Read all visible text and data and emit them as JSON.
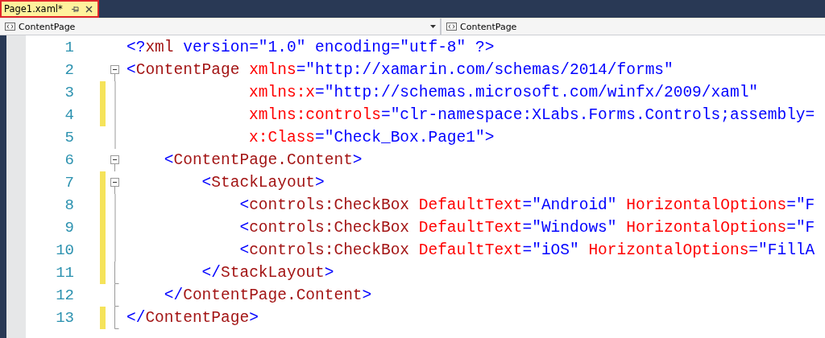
{
  "tab": {
    "title": "Page1.xaml*",
    "highlighted": true
  },
  "nav_bar": {
    "left": "ContentPage",
    "right": "ContentPage"
  },
  "editor": {
    "lines": [
      {
        "number": "1",
        "changed": false,
        "fold_start": false,
        "fold_end": false,
        "tokens": [
          {
            "kind": "punct",
            "text": "<?"
          },
          {
            "kind": "element",
            "text": "xml"
          },
          {
            "kind": "value",
            "text": " version=\"1.0\" encoding=\"utf-8\" "
          },
          {
            "kind": "punct",
            "text": "?>"
          }
        ]
      },
      {
        "number": "2",
        "changed": false,
        "fold_start": true,
        "fold_end": false,
        "tokens": [
          {
            "kind": "punct",
            "text": "<"
          },
          {
            "kind": "element",
            "text": "ContentPage"
          },
          {
            "kind": "attr",
            "text": " xmlns"
          },
          {
            "kind": "punct",
            "text": "="
          },
          {
            "kind": "value",
            "text": "\"http://xamarin.com/schemas/2014/forms\""
          }
        ]
      },
      {
        "number": "3",
        "changed": true,
        "fold_start": false,
        "fold_end": false,
        "tokens": [
          {
            "kind": "attr",
            "text": "             xmlns:x"
          },
          {
            "kind": "punct",
            "text": "="
          },
          {
            "kind": "value",
            "text": "\"http://schemas.microsoft.com/winfx/2009/xaml\""
          }
        ]
      },
      {
        "number": "4",
        "changed": true,
        "fold_start": false,
        "fold_end": false,
        "tokens": [
          {
            "kind": "attr",
            "text": "             xmlns:controls"
          },
          {
            "kind": "punct",
            "text": "="
          },
          {
            "kind": "value",
            "text": "\"clr-namespace:XLabs.Forms.Controls;assembly="
          }
        ]
      },
      {
        "number": "5",
        "changed": false,
        "fold_start": false,
        "fold_end": false,
        "tokens": [
          {
            "kind": "attr",
            "text": "             x:Class"
          },
          {
            "kind": "punct",
            "text": "="
          },
          {
            "kind": "value",
            "text": "\"Check_Box.Page1\""
          },
          {
            "kind": "punct",
            "text": ">"
          }
        ]
      },
      {
        "number": "6",
        "changed": false,
        "fold_start": true,
        "fold_end": false,
        "tokens": [
          {
            "kind": "punct",
            "text": "    <"
          },
          {
            "kind": "element",
            "text": "ContentPage.Content"
          },
          {
            "kind": "punct",
            "text": ">"
          }
        ]
      },
      {
        "number": "7",
        "changed": true,
        "fold_start": true,
        "fold_end": false,
        "tokens": [
          {
            "kind": "punct",
            "text": "        <"
          },
          {
            "kind": "element",
            "text": "StackLayout"
          },
          {
            "kind": "punct",
            "text": ">"
          }
        ]
      },
      {
        "number": "8",
        "changed": true,
        "fold_start": false,
        "fold_end": false,
        "tokens": [
          {
            "kind": "punct",
            "text": "            <"
          },
          {
            "kind": "element",
            "text": "controls:CheckBox"
          },
          {
            "kind": "attr",
            "text": " DefaultText"
          },
          {
            "kind": "punct",
            "text": "="
          },
          {
            "kind": "value",
            "text": "\"Android\""
          },
          {
            "kind": "attr",
            "text": " HorizontalOptions"
          },
          {
            "kind": "punct",
            "text": "="
          },
          {
            "kind": "value",
            "text": "\"F"
          }
        ]
      },
      {
        "number": "9",
        "changed": true,
        "fold_start": false,
        "fold_end": false,
        "tokens": [
          {
            "kind": "punct",
            "text": "            <"
          },
          {
            "kind": "element",
            "text": "controls:CheckBox"
          },
          {
            "kind": "attr",
            "text": " DefaultText"
          },
          {
            "kind": "punct",
            "text": "="
          },
          {
            "kind": "value",
            "text": "\"Windows\""
          },
          {
            "kind": "attr",
            "text": " HorizontalOptions"
          },
          {
            "kind": "punct",
            "text": "="
          },
          {
            "kind": "value",
            "text": "\"F"
          }
        ]
      },
      {
        "number": "10",
        "changed": true,
        "fold_start": false,
        "fold_end": false,
        "tokens": [
          {
            "kind": "punct",
            "text": "            <"
          },
          {
            "kind": "element",
            "text": "controls:CheckBox"
          },
          {
            "kind": "attr",
            "text": " DefaultText"
          },
          {
            "kind": "punct",
            "text": "="
          },
          {
            "kind": "value",
            "text": "\"iOS\""
          },
          {
            "kind": "attr",
            "text": " HorizontalOptions"
          },
          {
            "kind": "punct",
            "text": "="
          },
          {
            "kind": "value",
            "text": "\"FillA"
          }
        ]
      },
      {
        "number": "11",
        "changed": true,
        "fold_start": false,
        "fold_end": true,
        "tokens": [
          {
            "kind": "punct",
            "text": "        </"
          },
          {
            "kind": "element",
            "text": "StackLayout"
          },
          {
            "kind": "punct",
            "text": ">"
          }
        ]
      },
      {
        "number": "12",
        "changed": false,
        "fold_start": false,
        "fold_end": true,
        "tokens": [
          {
            "kind": "punct",
            "text": "    </"
          },
          {
            "kind": "element",
            "text": "ContentPage.Content"
          },
          {
            "kind": "punct",
            "text": ">"
          }
        ]
      },
      {
        "number": "13",
        "changed": true,
        "fold_start": false,
        "fold_end": true,
        "tokens": [
          {
            "kind": "punct",
            "text": "</"
          },
          {
            "kind": "element",
            "text": "ContentPage"
          },
          {
            "kind": "punct",
            "text": ">"
          }
        ]
      }
    ]
  }
}
